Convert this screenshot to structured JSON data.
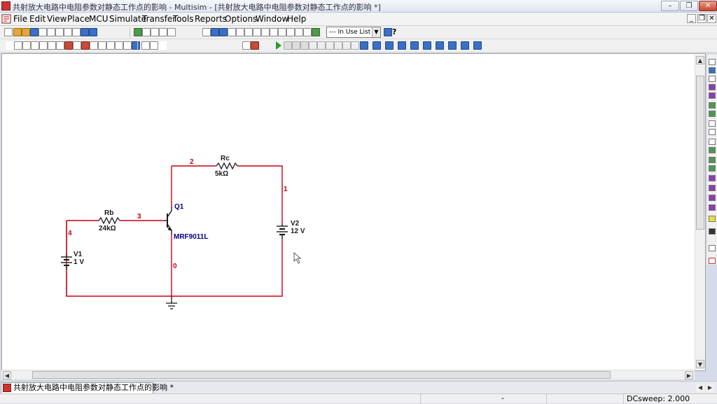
{
  "window": {
    "title": "共射放大电路中电阻参数对静态工作点的影响 - Multisim - [共射放大电路中电阻参数对静态工作点的影响 *]"
  },
  "menu": {
    "items": [
      "File",
      "Edit",
      "View",
      "Place",
      "MCU",
      "Simulate",
      "Transfer",
      "Tools",
      "Reports",
      "Options",
      "Window",
      "Help"
    ]
  },
  "toolbar": {
    "in_use_list": "--- In Use List ---"
  },
  "schematic": {
    "components": {
      "rb": {
        "ref": "Rb",
        "value": "24kΩ"
      },
      "rc": {
        "ref": "Rc",
        "value": "5kΩ"
      },
      "q1": {
        "ref": "Q1",
        "model": "MRF9011L"
      },
      "v1": {
        "ref": "V1",
        "value": "1 V"
      },
      "v2": {
        "ref": "V2",
        "value": "12 V"
      }
    },
    "nets": {
      "n0": "0",
      "n1": "1",
      "n2": "2",
      "n3": "3",
      "n4": "4"
    }
  },
  "tabs": [
    {
      "label": "共射放大电路中电阻参数对静态工作点的影响 *"
    }
  ],
  "status": {
    "text": "DCsweep: 2.000",
    "divider": "-"
  },
  "colors": {
    "wire": "#c80014",
    "component": "#1a1a1a",
    "label": "#000080",
    "net": "#c80014"
  }
}
